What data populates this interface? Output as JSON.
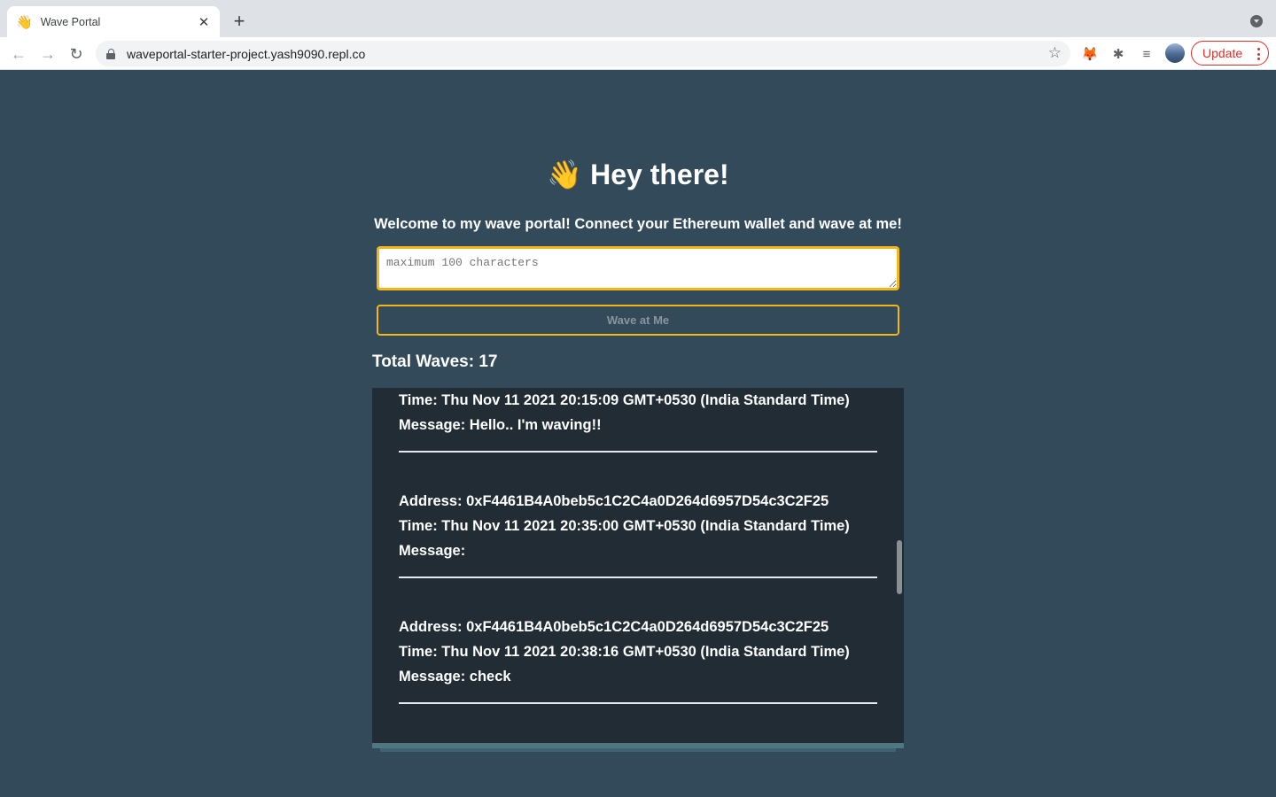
{
  "browser": {
    "tab_title": "Wave Portal",
    "tab_icon": "👋",
    "url": "waveportal-starter-project.yash9090.repl.co",
    "update_label": "Update"
  },
  "page": {
    "header_emoji": "👋",
    "header_text": "Hey there!",
    "bio": "Welcome to my wave portal! Connect your Ethereum wallet and wave at me!",
    "message_placeholder": "maximum 100 characters",
    "wave_button": "Wave at Me",
    "total_waves": "Total Waves: 17"
  },
  "waves": [
    {
      "time": "Time: Thu Nov 11 2021 20:15:09 GMT+0530 (India Standard Time)",
      "message": "Message: Hello.. I'm waving!!"
    },
    {
      "address": "Address: 0xF4461B4A0beb5c1C2C4a0D264d6957D54c3C2F25",
      "time": "Time: Thu Nov 11 2021 20:35:00 GMT+0530 (India Standard Time)",
      "message": "Message:"
    },
    {
      "address": "Address: 0xF4461B4A0beb5c1C2C4a0D264d6957D54c3C2F25",
      "time": "Time: Thu Nov 11 2021 20:38:16 GMT+0530 (India Standard Time)",
      "message": "Message: check"
    }
  ],
  "colors": {
    "page_bg": "#324a59",
    "accent": "#f5b716",
    "list_bg": "#212c34"
  }
}
